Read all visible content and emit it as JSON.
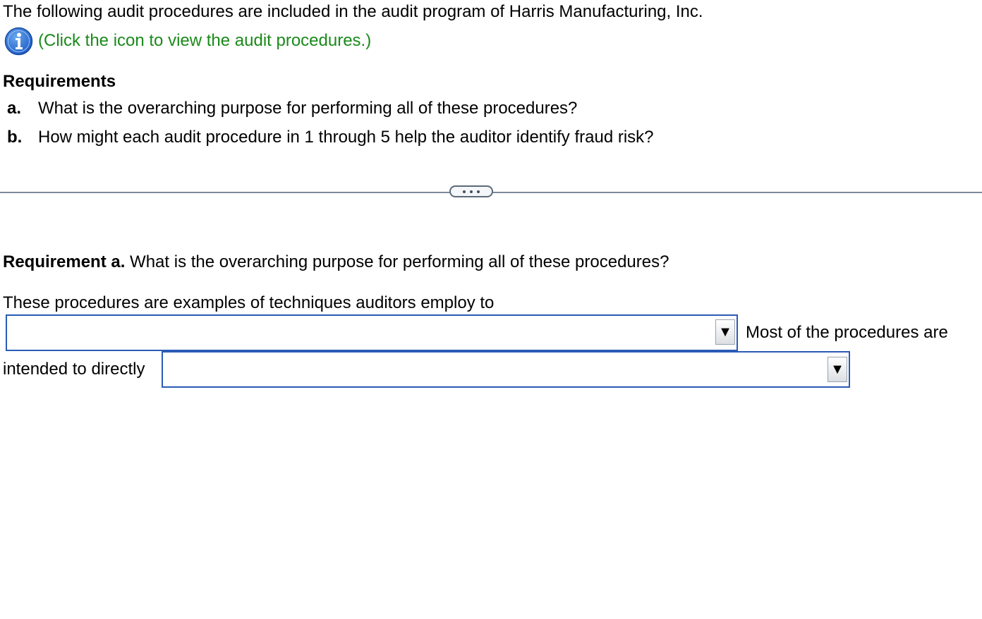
{
  "intro": {
    "text": "The following audit procedures are included in the audit program of Harris Manufacturing, Inc.",
    "info_link": "(Click the icon to view the audit procedures.)",
    "info_icon": "info-icon",
    "link_color": "#1a8a1a"
  },
  "requirements": {
    "heading": "Requirements",
    "items": [
      {
        "letter": "a.",
        "text": "What is the overarching purpose for performing all of these procedures?"
      },
      {
        "letter": "b.",
        "text": "How might each audit procedure in 1 through 5 help the auditor identify fraud risk?"
      }
    ]
  },
  "requirement_a": {
    "label": "Requirement a.",
    "question": " What is the overarching purpose for performing all of these procedures?",
    "answer_lead": "These procedures are examples of techniques auditors employ to",
    "answer_middle": "Most of the procedures are",
    "answer_tail": "intended to directly",
    "dropdown_1": {
      "selected": ""
    },
    "dropdown_2": {
      "selected": ""
    }
  },
  "colors": {
    "dropdown_border": "#2a5bb5",
    "divider": "#7d8a99"
  }
}
